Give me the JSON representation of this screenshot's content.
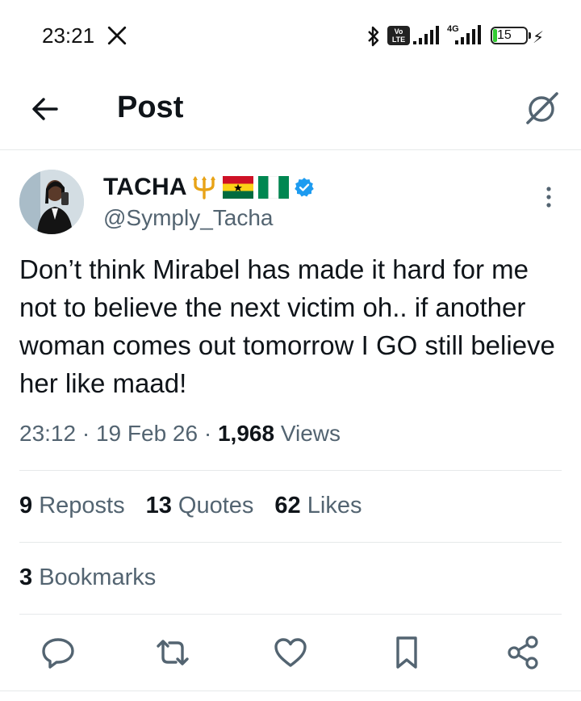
{
  "status_bar": {
    "time": "23:21",
    "network": "4G",
    "volte": "Vo LTE",
    "battery": "15"
  },
  "header": {
    "title": "Post",
    "back_icon": "arrow-left-icon",
    "grok_icon": "grok-icon"
  },
  "post": {
    "author_name": "TACHA",
    "author_handle": "@Symply_Tacha",
    "verified": true,
    "text": "Don’t think Mirabel has made it hard for me not to believe the next victim oh.. if another woman comes out tomorrow I GO still believe her like maad!",
    "time": "23:12",
    "date": "19 Feb 26",
    "views_count": "1,968",
    "views_label": "Views",
    "reposts_count": "9",
    "reposts_label": "Reposts",
    "quotes_count": "13",
    "quotes_label": "Quotes",
    "likes_count": "62",
    "likes_label": "Likes",
    "bookmarks_count": "3",
    "bookmarks_label": "Bookmarks"
  },
  "colors": {
    "text_primary": "#0f1419",
    "text_secondary": "#536471",
    "verified_blue": "#1d9bf0",
    "divider": "#e6e9ea"
  }
}
